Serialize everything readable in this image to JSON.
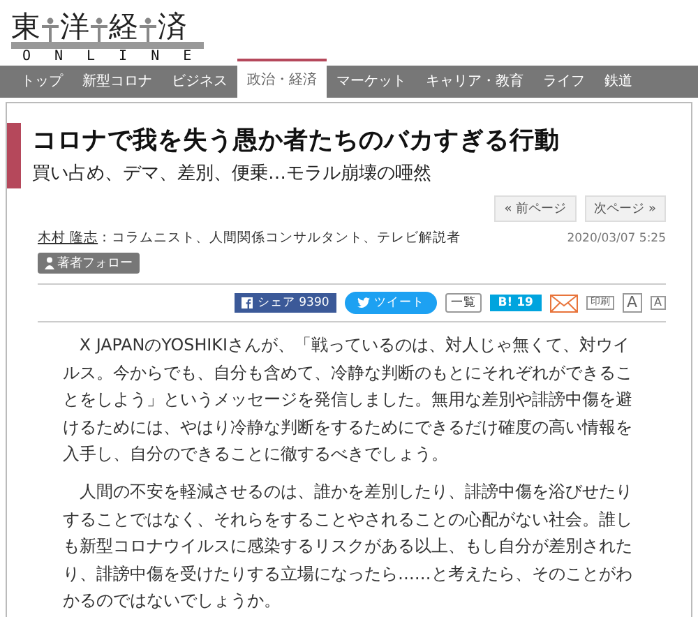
{
  "logo": {
    "chars": [
      "東",
      "洋",
      "経",
      "済"
    ],
    "subtitle": "ONLINE"
  },
  "nav": [
    {
      "label": "トップ",
      "selected": false
    },
    {
      "label": "新型コロナ",
      "selected": false
    },
    {
      "label": "ビジネス",
      "selected": false
    },
    {
      "label": "政治・経済",
      "selected": true
    },
    {
      "label": "マーケット",
      "selected": false
    },
    {
      "label": "キャリア・教育",
      "selected": false
    },
    {
      "label": "ライフ",
      "selected": false
    },
    {
      "label": "鉄道",
      "selected": false
    }
  ],
  "article": {
    "title": "コロナで我を失う愚か者たちのバカすぎる行動",
    "subtitle": "買い占め、デマ、差別、便乗…モラル崩壊の唖然",
    "pager": [
      "« 前ページ",
      "次ページ »"
    ],
    "author": "木村 隆志",
    "author_role": "：コラムニスト、人間関係コンサルタント、テレビ解説者",
    "date": "2020/03/07 5:25",
    "follow": "著者フォロー",
    "share": {
      "facebook": "シェア 9390",
      "twitter": "ツイート",
      "list": "一覧",
      "hatena_mark": "B!",
      "hatena_count": "19",
      "print": "印刷",
      "font_large": "A",
      "font_small": "A"
    },
    "paragraphs": [
      "X JAPANのYOSHIKIさんが、「戦っているのは、対人じゃ無くて、対ウイルス。今からでも、自分も含めて、冷静な判断のもとにそれぞれができることをしよう」というメッセージを発信しました。無用な差別や誹謗中傷を避けるためには、やはり冷静な判断をするためにできるだけ確度の高い情報を入手し、自分のできることに徹するべきでしょう。",
      "人間の不安を軽減させるのは、誰かを差別したり、誹謗中傷を浴びせたりすることではなく、それらをすることやされることの心配がない社会。誰しも新型コロナウイルスに感染するリスクがある以上、もし自分が差別されたり、誹謗中傷を受けたりする立場になったら……と考えたら、そのことがわかるのではないでしょうか。"
    ]
  }
}
